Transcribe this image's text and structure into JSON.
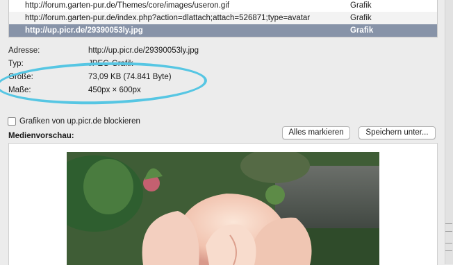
{
  "media_list": {
    "rows": [
      {
        "address": "http://forum.garten-pur.de/Themes/core/images/useron.gif",
        "type": "Grafik",
        "selected": false
      },
      {
        "address": "http://forum.garten-pur.de/index.php?action=dlattach;attach=526871;type=avatar",
        "type": "Grafik",
        "selected": false
      },
      {
        "address": "http://up.picr.de/29390053ly.jpg",
        "type": "Grafik",
        "selected": true
      }
    ]
  },
  "details": {
    "address_label": "Adresse:",
    "address_value": "http://up.picr.de/29390053ly.jpg",
    "type_label": "Typ:",
    "type_value": "JPEG-Grafik",
    "size_label": "Größe:",
    "size_value": "73,09 KB (74.841 Byte)",
    "dimensions_label": "Maße:",
    "dimensions_value": "450px × 600px"
  },
  "block_checkbox": {
    "label": "Grafiken von up.picr.de blockieren",
    "checked": false
  },
  "buttons": {
    "select_all": "Alles markieren",
    "save_as": "Speichern unter..."
  },
  "preview": {
    "heading": "Medienvorschau:"
  },
  "colors": {
    "selection": "#8793a8",
    "highlight_ring": "#56c6e3"
  }
}
